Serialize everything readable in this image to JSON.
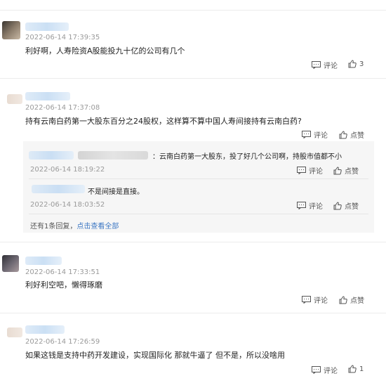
{
  "comments": [
    {
      "time": "2022-06-14 17:39:35",
      "text": "利好啊，人寿险资A股能投九十亿的公司有几个",
      "reply_label": "评论",
      "like_count": "3"
    },
    {
      "time": "2022-06-14 17:37:08",
      "text": "持有云南白药第一大股东百分之24股权，这样算不算中国人寿间接持有云南白药?",
      "reply_label": "评论",
      "like_label": "点赞",
      "replies": [
        {
          "text": "：云南白药第一大股东，投了好几个公司啊，持股市值都不小",
          "time": "2022-06-14 18:19:22",
          "reply_label": "评论",
          "like_label": "点赞"
        },
        {
          "text": "不是间接是直接。",
          "time": "2022-06-14 18:03:52",
          "reply_label": "评论",
          "like_label": "点赞"
        }
      ],
      "more_replies": "还有1条回复，",
      "more_link": "点击查看全部"
    },
    {
      "time": "2022-06-14 17:33:51",
      "text": "利好利空吧，懒得琢磨",
      "reply_label": "评论",
      "like_label": "点赞"
    },
    {
      "time": "2022-06-14 17:26:59",
      "text": "如果这钱是支持中药开发建设，实现国际化 那就牛逼了 但不是，所以没啥用",
      "reply_label": "评论",
      "like_count": "1"
    }
  ],
  "icons": {
    "comment": "comment-icon",
    "like": "thumbs-up-icon"
  },
  "colors": {
    "link": "#3d78c4",
    "reply_bg": "#f6f6f6",
    "time": "#9a9a9a"
  }
}
